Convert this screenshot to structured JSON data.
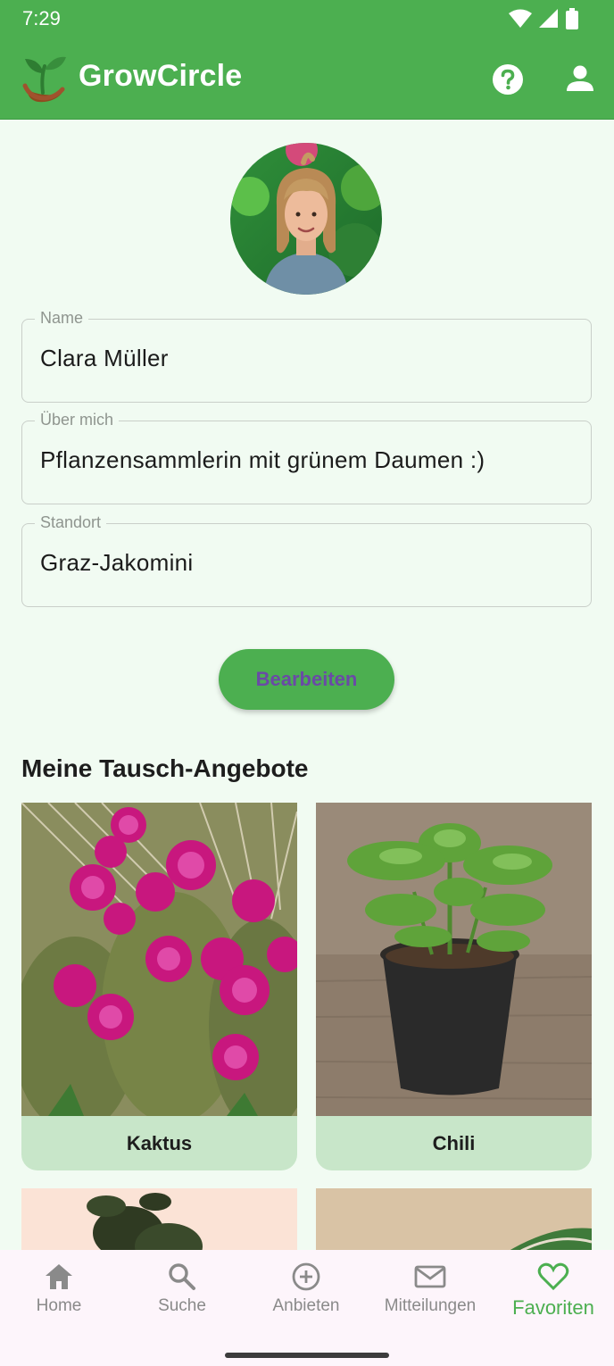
{
  "status_bar": {
    "time": "7:29"
  },
  "app_bar": {
    "title": "GrowCircle",
    "help_icon": "help-circle-icon",
    "account_icon": "person-icon",
    "color": "#4caf50"
  },
  "profile": {
    "name_label": "Name",
    "name_value": "Clara Müller",
    "about_label": "Über mich",
    "about_value": "Pflanzensammlerin mit grünem Daumen :)",
    "location_label": "Standort",
    "location_value": "Graz-Jakomini",
    "edit_button": "Bearbeiten"
  },
  "offers": {
    "title": "Meine Tausch-Angebote",
    "items": [
      {
        "label": "Kaktus"
      },
      {
        "label": "Chili"
      }
    ]
  },
  "bottom_nav": {
    "items": [
      {
        "label": "Home",
        "icon": "home-icon"
      },
      {
        "label": "Suche",
        "icon": "search-icon"
      },
      {
        "label": "Anbieten",
        "icon": "add-circle-icon"
      },
      {
        "label": "Mitteilungen",
        "icon": "mail-icon"
      },
      {
        "label": "Favoriten",
        "icon": "heart-icon",
        "active": true
      }
    ],
    "active_color": "#4caf50"
  }
}
